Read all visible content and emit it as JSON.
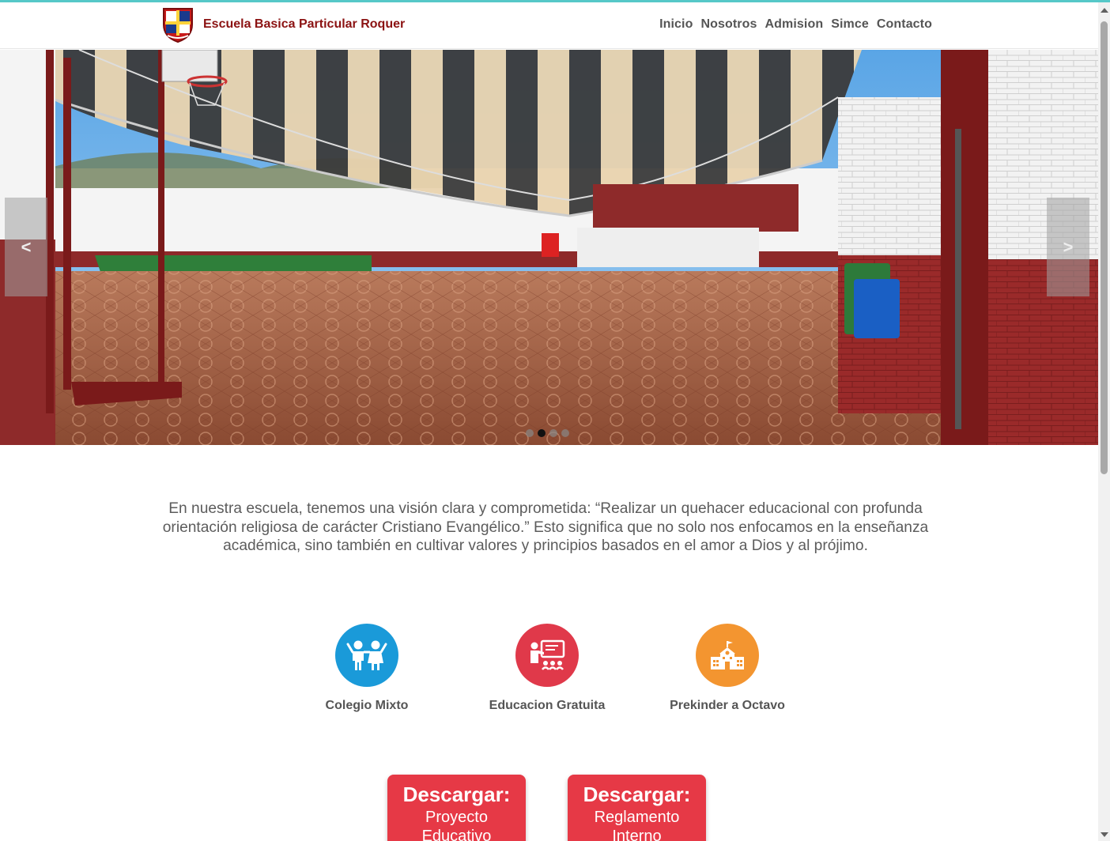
{
  "brand": {
    "name": "Escuela Basica Particular Roquer"
  },
  "nav": {
    "items": [
      "Inicio",
      "Nosotros",
      "Admision",
      "Simce",
      "Contacto"
    ]
  },
  "carousel": {
    "prev_label": "<",
    "next_label": ">",
    "slide_count": 4,
    "active_index": 1,
    "image_desc_icon": "photo"
  },
  "vision": {
    "text": "En nuestra escuela, tenemos una visión clara y comprometida: “Realizar un quehacer educacional con profunda orientación religiosa de carácter Cristiano Evangélico.” Esto significa que no solo nos enfocamos en la enseñanza académica, sino también en cultivar valores y principios basados en el amor a Dios y al prójimo."
  },
  "features": [
    {
      "label": "Colegio Mixto",
      "icon": "children-icon",
      "color": "#1a9ad9"
    },
    {
      "label": "Educacion Gratuita",
      "icon": "teacher-board-icon",
      "color": "#e0394a"
    },
    {
      "label": "Prekinder a Octavo",
      "icon": "school-building-icon",
      "color": "#f39530"
    }
  ],
  "downloads": [
    {
      "title": "Descargar:",
      "subtitle_1": "Proyecto",
      "subtitle_2": "Educativo"
    },
    {
      "title": "Descargar:",
      "subtitle_1": "Reglamento",
      "subtitle_2": "Interno"
    }
  ],
  "colors": {
    "brand": "#8b1212",
    "accent": "#e63946",
    "topline": "#56c8c8"
  }
}
